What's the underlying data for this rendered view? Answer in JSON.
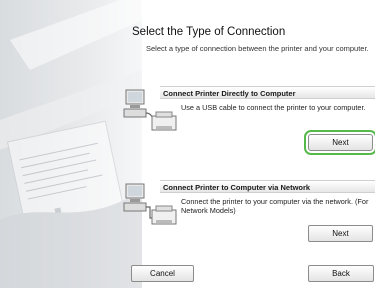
{
  "title": "Select the Type of Connection",
  "subtitle": "Select a type of connection between the printer and your computer.",
  "options": [
    {
      "header": "Connect Printer Directly to Computer",
      "description": "Use a USB cable to connect the printer to your computer.",
      "button": "Next",
      "icon": "computer-usb-printer-icon"
    },
    {
      "header": "Connect Printer to Computer via Network",
      "description": "Connect the printer to your computer via the network. (For Network Models)",
      "button": "Next",
      "icon": "computer-network-printer-icon"
    }
  ],
  "footer": {
    "cancel": "Cancel",
    "back": "Back"
  },
  "colors": {
    "highlight": "#57b94b",
    "header_bar": "#e6e6e6"
  }
}
